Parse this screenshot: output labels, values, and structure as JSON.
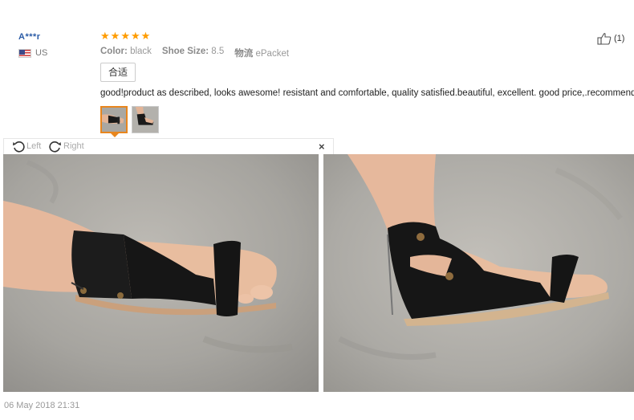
{
  "reviewer": {
    "name": "A***r",
    "country": "US",
    "flag_icon": "us-flag-icon"
  },
  "rating": {
    "stars": 5,
    "max": 5,
    "color": "#ff9c00"
  },
  "attributes": {
    "color_label": "Color:",
    "color_value": "black",
    "size_label": "Shoe Size:",
    "size_value": "8.5",
    "shipping_label": "物流",
    "shipping_value": "ePacket"
  },
  "translate_button": "合适",
  "helpful": {
    "icon": "thumbs-up-icon",
    "count": "(1)"
  },
  "review_text": "good!product as described, looks awesome! resistant and comfortable, quality satisfied.beautiful, excellent. good price,.recommend",
  "thumbnails": [
    {
      "name": "photo-1",
      "active": true
    },
    {
      "name": "photo-2",
      "active": false
    }
  ],
  "viewer": {
    "rotate_left_label": "Left",
    "rotate_right_label": "Right",
    "close_label": "×"
  },
  "date": "06 May 2018 21:31",
  "colors": {
    "link_blue": "#2a5ba6",
    "accent_orange": "#e8861e"
  }
}
